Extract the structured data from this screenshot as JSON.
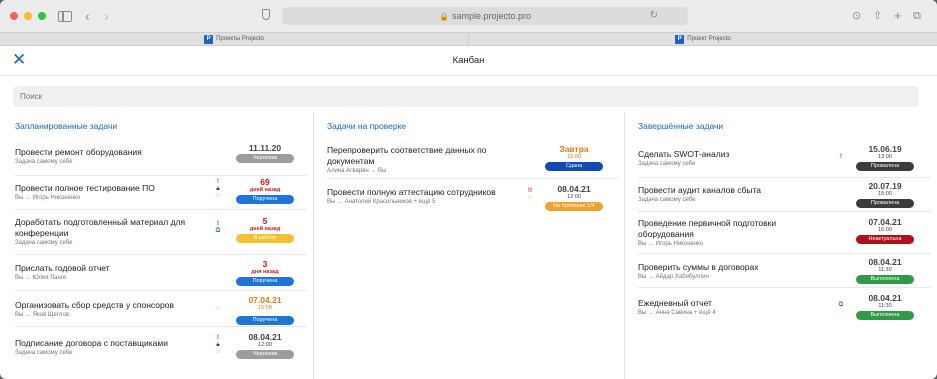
{
  "browser": {
    "url": "sample.projecto.pro",
    "tabs": [
      {
        "label": "Проекты Projecto",
        "logo": "P"
      },
      {
        "label": "Проект Projecto",
        "logo": "P"
      }
    ]
  },
  "app": {
    "title": "Канбан",
    "search_placeholder": "Поиск"
  },
  "colors": {
    "accent": "#1a64c2",
    "badge_grey": "#9d9d9d",
    "badge_blue": "#1e75d8",
    "badge_yellow": "#f2c230",
    "badge_navy": "#1249b3",
    "badge_orange": "#f2a12d",
    "badge_dark": "#3c3c3c",
    "badge_darkred": "#b0121d",
    "badge_green": "#2f9b45"
  },
  "columns": [
    {
      "title": "Запланированные задачи",
      "tasks": [
        {
          "name": "Провести ремонт оборудования",
          "sub": "Задача самому себе",
          "due": "11.11.20",
          "due_time": "",
          "status": "Черновик"
        },
        {
          "name": "Провести полное тестирование ПО",
          "sub": "Вы → Игорь Никоненко",
          "due": "69",
          "due_time": "дней назад",
          "status": "Поручена"
        },
        {
          "name": "Доработать подготовленный материал для конференции",
          "sub": "Задача самому себе",
          "due": "5",
          "due_time": "дней назад",
          "status": "В работе"
        },
        {
          "name": "Прислать годовой отчет",
          "sub": "Вы → Юлия Ланге",
          "due": "3",
          "due_time": "дня назад",
          "status": "Поручена"
        },
        {
          "name": "Организовать сбор средств у спонсоров",
          "sub": "Вы → Яков Щеглов",
          "due": "07.04.21",
          "due_time": "15:00",
          "status": "Поручена"
        },
        {
          "name": "Подписание договора с поставщиками",
          "sub": "Задача самому себе",
          "due": "08.04.21",
          "due_time": "12:00",
          "status": "Черновик"
        }
      ]
    },
    {
      "title": "Задачи на проверке",
      "tasks": [
        {
          "name": "Перепроверить соответствие данных по документам",
          "sub": "Алина Агварян → Вы",
          "due": "Завтра",
          "due_time": "15:00",
          "status": "Сдана"
        },
        {
          "name": "Провести полную аттестацию сотрудников",
          "sub": "Вы → Анатолий Красильников + ещё 5",
          "due": "08.04.21",
          "due_time": "12:00",
          "status": "На проверке 1/4"
        }
      ]
    },
    {
      "title": "Завершённые задачи",
      "tasks": [
        {
          "name": "Сделать SWOT-анализ",
          "sub": "Задача самому себе",
          "due": "15.06.19",
          "due_time": "13:00",
          "status": "Провалена"
        },
        {
          "name": "Провести аудит каналов сбыта",
          "sub": "Задача самому себе",
          "due": "20.07.19",
          "due_time": "15:00",
          "status": "Провалена"
        },
        {
          "name": "Проведение первичной подготовки оборудования",
          "sub": "Вы → Игорь Никоненко",
          "due": "07.04.21",
          "due_time": "16:00",
          "status": "Неактуальна"
        },
        {
          "name": "Проверить суммы в договорах",
          "sub": "Вы → Айдар Хабибуллин",
          "due": "08.04.21",
          "due_time": "11:30",
          "status": "Выполнена"
        },
        {
          "name": "Ежедневный отчет",
          "sub": "Вы → Анна Савина + ещё 4",
          "due": "08.04.21",
          "due_time": "11:30",
          "status": "Выполнена"
        }
      ]
    }
  ]
}
